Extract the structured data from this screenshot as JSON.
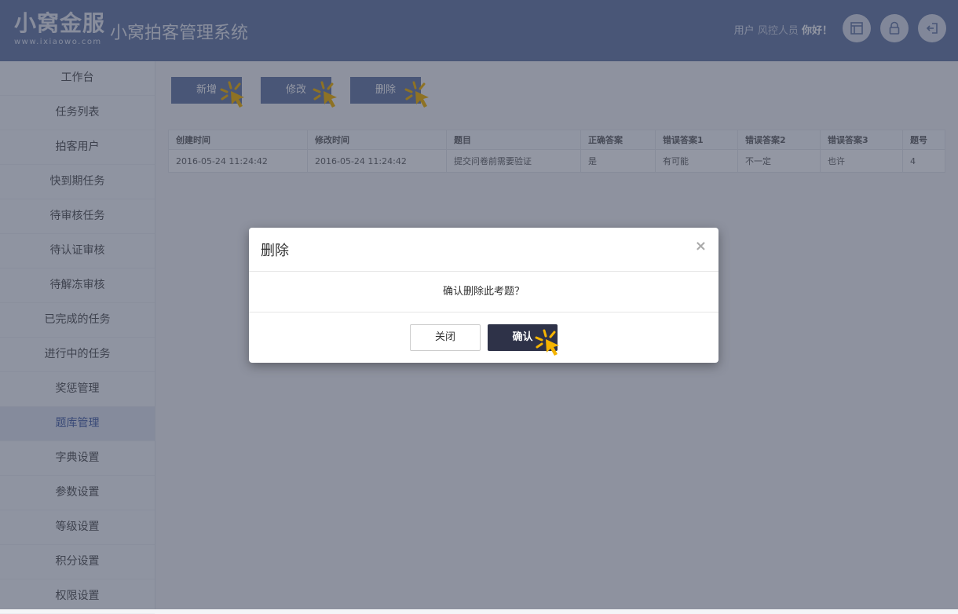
{
  "header": {
    "brand_main": "小窝金服",
    "brand_sub": "www.ixiaowo.com",
    "app_title": "小窝拍客管理系统",
    "user_prefix": "用户",
    "user_name": "风控人员",
    "greeting": "你好！"
  },
  "sidebar": {
    "items": [
      {
        "label": "工作台"
      },
      {
        "label": "任务列表"
      },
      {
        "label": "拍客用户"
      },
      {
        "label": "快到期任务"
      },
      {
        "label": "待审核任务"
      },
      {
        "label": "待认证审核"
      },
      {
        "label": "待解冻审核"
      },
      {
        "label": "已完成的任务"
      },
      {
        "label": "进行中的任务"
      },
      {
        "label": "奖惩管理"
      },
      {
        "label": "题库管理"
      },
      {
        "label": "字典设置"
      },
      {
        "label": "参数设置"
      },
      {
        "label": "等级设置"
      },
      {
        "label": "积分设置"
      },
      {
        "label": "权限设置"
      }
    ],
    "active": "题库管理"
  },
  "toolbar": {
    "add_label": "新增",
    "edit_label": "修改",
    "delete_label": "删除"
  },
  "table": {
    "headers": [
      "创建时间",
      "修改时间",
      "题目",
      "正确答案",
      "错误答案1",
      "错误答案2",
      "错误答案3",
      "题号"
    ],
    "rows": [
      [
        "2016-05-24 11:24:42",
        "2016-05-24 11:24:42",
        "提交问卷前需要验证",
        "是",
        "有可能",
        "不一定",
        "也许",
        "4"
      ]
    ]
  },
  "modal": {
    "title": "删除",
    "close_symbol": "×",
    "message": "确认删除此考题？",
    "cancel_label": "关闭",
    "confirm_label": "确认"
  },
  "colors": {
    "header_bg": "#6b7da6",
    "confirm_bg": "#2e3248",
    "cursor": "#f5b400"
  }
}
